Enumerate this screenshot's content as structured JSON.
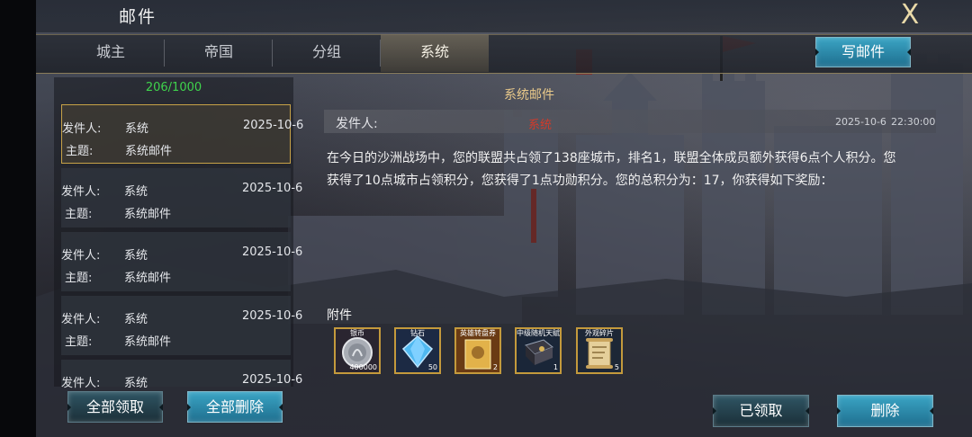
{
  "window": {
    "title": "邮件",
    "close_label": "X"
  },
  "tabs": [
    {
      "label": "城主"
    },
    {
      "label": "帝国"
    },
    {
      "label": "分组"
    },
    {
      "label": "系统"
    }
  ],
  "active_tab": "系统",
  "compose_button": "写邮件",
  "mail_list": {
    "count": "206/1000",
    "sender_label": "发件人:",
    "subject_label": "主题:",
    "items": [
      {
        "sender": "系统",
        "date": "2025-10-6",
        "subject": "系统邮件"
      },
      {
        "sender": "系统",
        "date": "2025-10-6",
        "subject": "系统邮件"
      },
      {
        "sender": "系统",
        "date": "2025-10-6",
        "subject": "系统邮件"
      },
      {
        "sender": "系统",
        "date": "2025-10-6",
        "subject": "系统邮件"
      },
      {
        "sender": "系统",
        "date": "2025-10-6",
        "subject": ""
      }
    ]
  },
  "list_buttons": {
    "collect_all": "全部领取",
    "delete_all": "全部删除"
  },
  "detail": {
    "title": "系统邮件",
    "sender_label": "发件人:",
    "sender": "系统",
    "date": "2025-10-6",
    "time": "22:30:00",
    "body_line1": "在今日的沙洲战场中，您的联盟共占领了138座城市，排名1，联盟全体成员额外获得6点个人积分。您",
    "body_line2": "获得了10点城市占领积分，您获得了1点功勋积分。您的总积分为：17，你获得如下奖励：",
    "attachments_label": "附件",
    "attachments": [
      {
        "name": "银币",
        "count": "400000",
        "icon": "silver-coin-icon"
      },
      {
        "name": "钻石",
        "count": "50",
        "icon": "diamond-icon"
      },
      {
        "name": "英雄转盘券",
        "count": "2",
        "icon": "hero-ticket-icon"
      },
      {
        "name": "中级随机天赋",
        "count": "1",
        "icon": "talent-book-icon"
      },
      {
        "name": "外观碎片",
        "count": "5",
        "icon": "scroll-map-icon"
      }
    ],
    "claimed_button": "已领取",
    "delete_button": "删除"
  },
  "colors": {
    "count_green": "#3fd34c",
    "sender_red": "#d33a2a",
    "gold_border": "#c49a3c",
    "accent_blue": "#2b8fb0"
  }
}
